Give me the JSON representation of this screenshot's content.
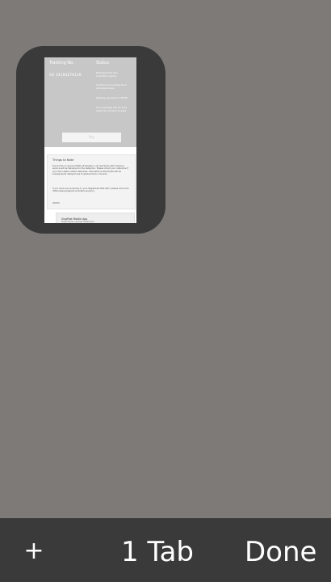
{
  "tab_card": {
    "thumbnail": {
      "tracking_label": "Tracking No.",
      "tracking_number": "SG 33184276128",
      "status_label": "Status",
      "status_lines": [
        "Package held at a Collection centre",
        "Confirm accounting at an arrival process",
        "Waiting payment to SPOP",
        "Your package will be sent when the amount is paid"
      ],
      "pay_label": "Pay",
      "notes_title": "Things to Note",
      "notes_paragraphs": [
        "Due to the on-going COVID-19 situation, all mail items with tracking service will be delivered to the detention. Please check your reference if your item status reflect delivered. International shipments will be subsequently delayed due to global border closures.",
        "If you have any enquiries on your Registered Mail item, please click here (http://www.singpost.com/item-enquiry)",
        "XXXXX"
      ],
      "app_title": "SingPost Mobile App",
      "app_subtitle": "Track items, receive mobile pa..."
    }
  },
  "bottom_bar": {
    "new_tab_label": "+",
    "tab_count_label": "1 Tab",
    "done_label": "Done"
  }
}
